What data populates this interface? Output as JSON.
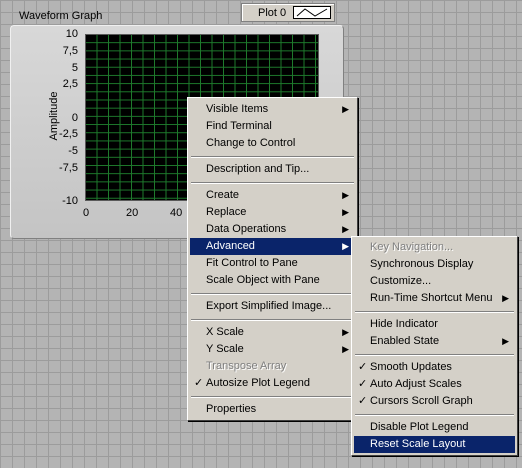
{
  "graph": {
    "title": "Waveform Graph",
    "legend_label": "Plot 0",
    "y_axis_label": "Amplitude",
    "y_ticks": [
      "10",
      "7,5",
      "5",
      "2,5",
      "0",
      "-2,5",
      "-5",
      "-7,5",
      "-10"
    ],
    "x_ticks": [
      "0",
      "20",
      "40"
    ],
    "plot_bg": "#000000",
    "grid_color": "#1e7a2c"
  },
  "main_menu": {
    "items": [
      {
        "label": "Visible Items",
        "arrow": "▶"
      },
      {
        "label": "Find Terminal"
      },
      {
        "label": "Change to Control"
      },
      {
        "label": "Description and Tip..."
      },
      {
        "label": "Create",
        "arrow": "▶"
      },
      {
        "label": "Replace",
        "arrow": "▶"
      },
      {
        "label": "Data Operations",
        "arrow": "▶"
      },
      {
        "label": "Advanced",
        "arrow": "▶"
      },
      {
        "label": "Fit Control to Pane"
      },
      {
        "label": "Scale Object with Pane"
      },
      {
        "label": "Export Simplified Image..."
      },
      {
        "label": "X Scale",
        "arrow": "▶"
      },
      {
        "label": "Y Scale",
        "arrow": "▶"
      },
      {
        "label": "Transpose Array"
      },
      {
        "label": "Autosize Plot Legend",
        "check": "✓"
      },
      {
        "label": "Properties"
      }
    ]
  },
  "sub_menu": {
    "items": [
      {
        "label": "Key Navigation..."
      },
      {
        "label": "Synchronous Display"
      },
      {
        "label": "Customize..."
      },
      {
        "label": "Run-Time Shortcut Menu",
        "arrow": "▶"
      },
      {
        "label": "Hide Indicator"
      },
      {
        "label": "Enabled State",
        "arrow": "▶"
      },
      {
        "label": "Smooth Updates",
        "check": "✓"
      },
      {
        "label": "Auto Adjust Scales",
        "check": "✓"
      },
      {
        "label": "Cursors Scroll Graph",
        "check": "✓"
      },
      {
        "label": "Disable Plot Legend"
      },
      {
        "label": "Reset Scale Layout"
      }
    ]
  },
  "colors": {
    "selection": "#0a246a",
    "menu_bg": "#d4d0c8"
  }
}
